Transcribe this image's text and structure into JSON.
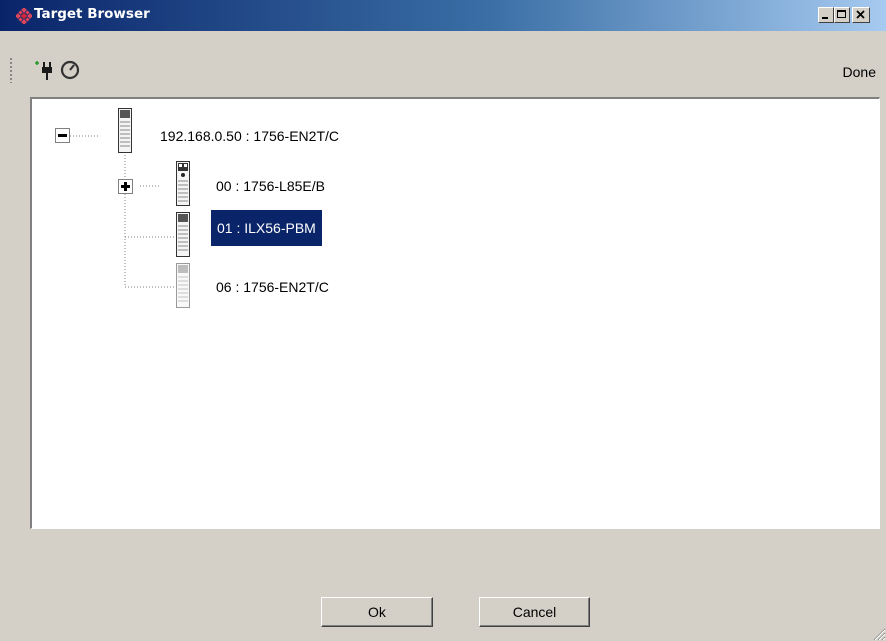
{
  "window": {
    "title": "Target Browser",
    "title_icon": "diamond-logo-icon",
    "controls": [
      "minimize",
      "maximize",
      "close"
    ]
  },
  "toolbar": {
    "icons": [
      "plug-connect-icon",
      "refresh-gauge-icon"
    ],
    "done_label": "Done"
  },
  "tree": {
    "root": {
      "label": "192.168.0.50 : 1756-EN2T/C",
      "expanded": true,
      "icon": "module-icon"
    },
    "children": [
      {
        "label": "00 : 1756-L85E/B",
        "expandable": true,
        "expanded": false,
        "selected": false,
        "icon": "controller-module-icon"
      },
      {
        "label": "01 : ILX56-PBM",
        "expandable": false,
        "selected": true,
        "icon": "module-icon"
      },
      {
        "label": "06 : 1756-EN2T/C",
        "expandable": false,
        "selected": false,
        "icon": "module-disabled-icon"
      }
    ]
  },
  "buttons": {
    "ok_label": "Ok",
    "cancel_label": "Cancel"
  },
  "colors": {
    "selection": "#0a246a",
    "titlebar_start": "#0a246a",
    "titlebar_end": "#a6caf0",
    "face": "#d4d0c8"
  }
}
